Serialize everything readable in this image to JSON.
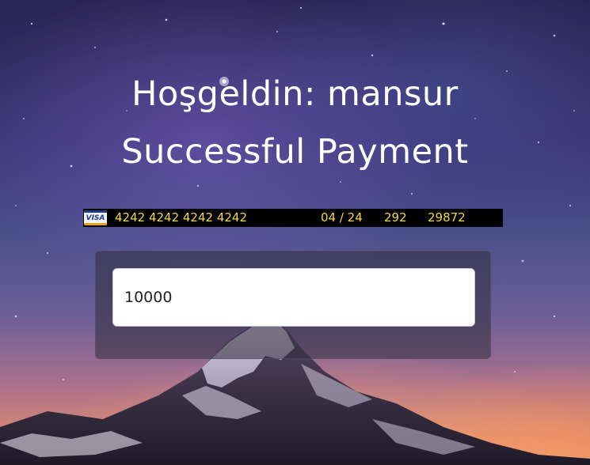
{
  "header": {
    "welcome_text": "Hoşgeldin: mansur",
    "status_text": "Successful Payment"
  },
  "card": {
    "brand": "VISA",
    "number": "4242 4242 4242 4242",
    "expiry": "04 / 24",
    "cvv": "292",
    "code": "29872"
  },
  "form": {
    "amount_value": "10000"
  },
  "colors": {
    "card_text": "#f3d64a",
    "strip_bg": "#000000",
    "heading": "#ffffff"
  }
}
